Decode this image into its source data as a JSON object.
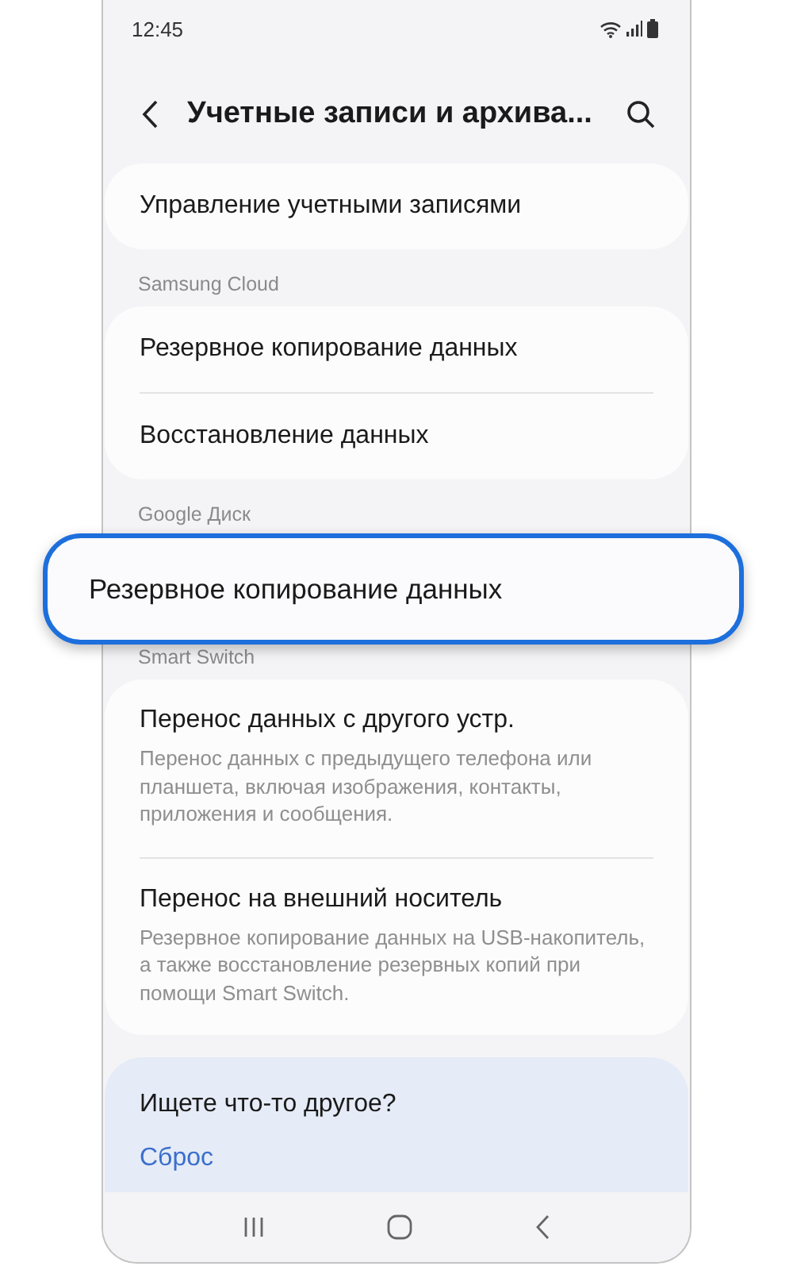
{
  "status_bar": {
    "time": "12:45"
  },
  "header": {
    "title": "Учетные записи и архива..."
  },
  "sections": [
    {
      "kind": "list",
      "items": [
        {
          "title": "Управление учетными записями"
        }
      ]
    },
    {
      "kind": "list",
      "header": "Samsung Cloud",
      "items": [
        {
          "title": "Резервное копирование данных"
        },
        {
          "title": "Восстановление данных"
        }
      ]
    },
    {
      "kind": "highlight",
      "header": "Google Диск",
      "callout": "Резервное копирование данных"
    },
    {
      "kind": "list",
      "header": "Smart Switch",
      "items": [
        {
          "title": "Перенос данных с другого устр.",
          "subtitle": "Перенос данных с предыдущего телефона или планшета, включая изображения, контакты, приложения и сообщения."
        },
        {
          "title": "Перенос на внешний носитель",
          "subtitle": "Резервное копирование данных на USB-накопитель, а также восстановление резервных копий при помощи Smart Switch."
        }
      ]
    }
  ],
  "help": {
    "title": "Ищете что-то другое?",
    "links": [
      "Сброс"
    ]
  }
}
